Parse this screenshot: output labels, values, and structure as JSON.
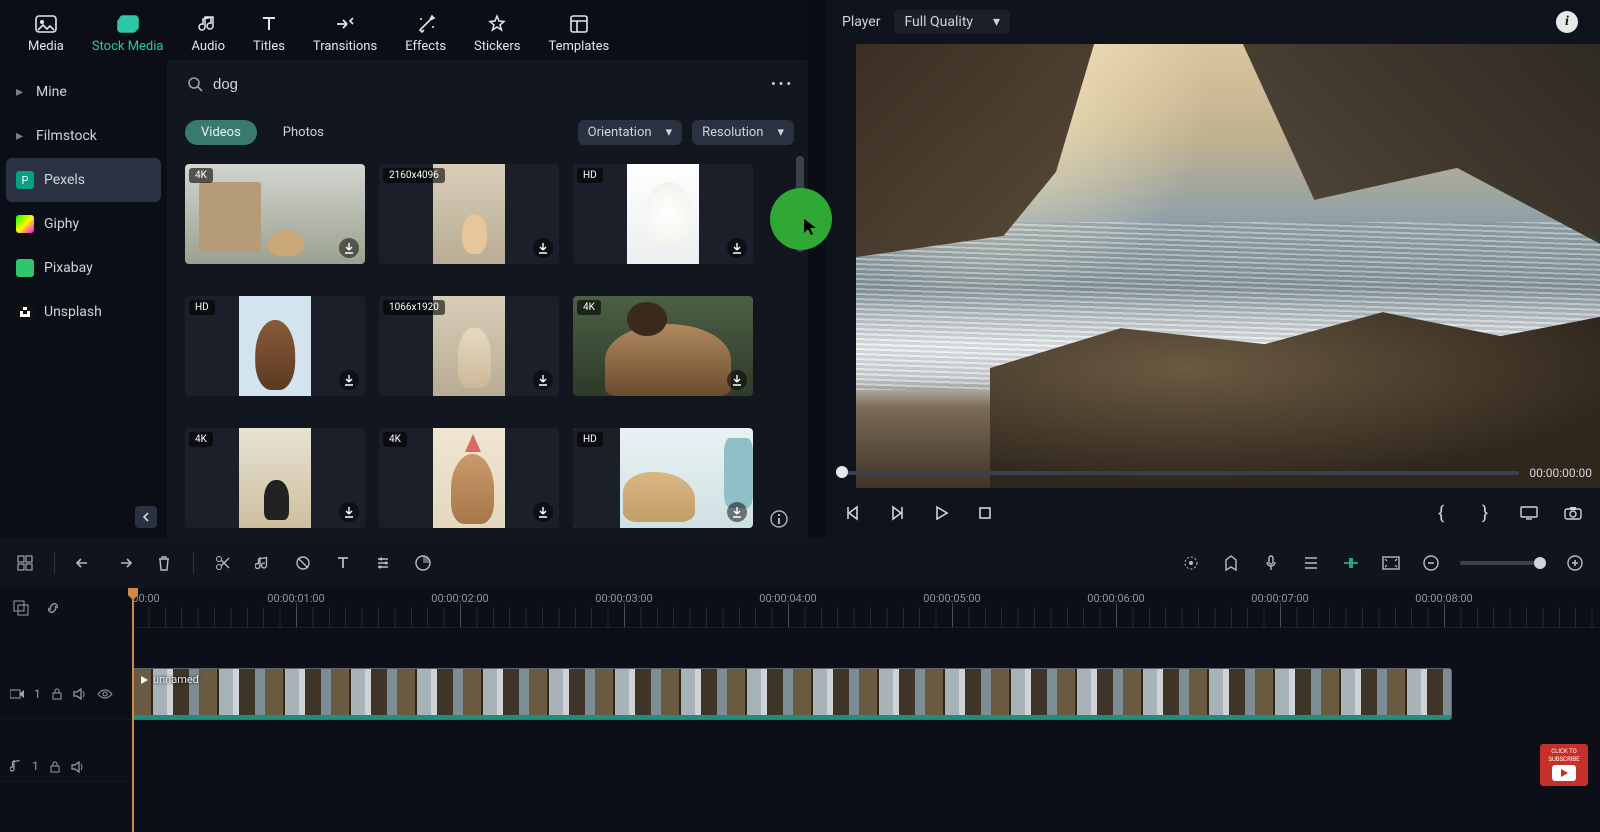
{
  "top_tabs": {
    "media": "Media",
    "stock_media": "Stock Media",
    "audio": "Audio",
    "titles": "Titles",
    "transitions": "Transitions",
    "effects": "Effects",
    "stickers": "Stickers",
    "templates": "Templates"
  },
  "sources": {
    "mine": "Mine",
    "filmstock": "Filmstock",
    "pexels": "Pexels",
    "giphy": "Giphy",
    "pixabay": "Pixabay",
    "unsplash": "Unsplash"
  },
  "search": {
    "value": "dog"
  },
  "type_tabs": {
    "videos": "Videos",
    "photos": "Photos"
  },
  "filters": {
    "orientation": "Orientation",
    "resolution": "Resolution"
  },
  "thumbs": [
    {
      "badge": "4K"
    },
    {
      "badge": "2160x4096"
    },
    {
      "badge": "HD"
    },
    {
      "badge": "HD"
    },
    {
      "badge": "1066x1920"
    },
    {
      "badge": "4K"
    },
    {
      "badge": "4K"
    },
    {
      "badge": "4K"
    },
    {
      "badge": "HD"
    }
  ],
  "player": {
    "label": "Player",
    "quality": "Full Quality",
    "timecode": "00:00:00:00"
  },
  "timeline": {
    "labels": [
      "00:00",
      "00:00:01:00",
      "00:00:02:00",
      "00:00:03:00",
      "00:00:04:00",
      "00:00:05:00",
      "00:00:06:00",
      "00:00:07:00",
      "00:00:08:00"
    ],
    "clip_name": "unnamed",
    "video_track": "1",
    "audio_track": "1"
  },
  "yt": {
    "line1": "CLICK TO",
    "line2": "SUBSCRIBE"
  }
}
